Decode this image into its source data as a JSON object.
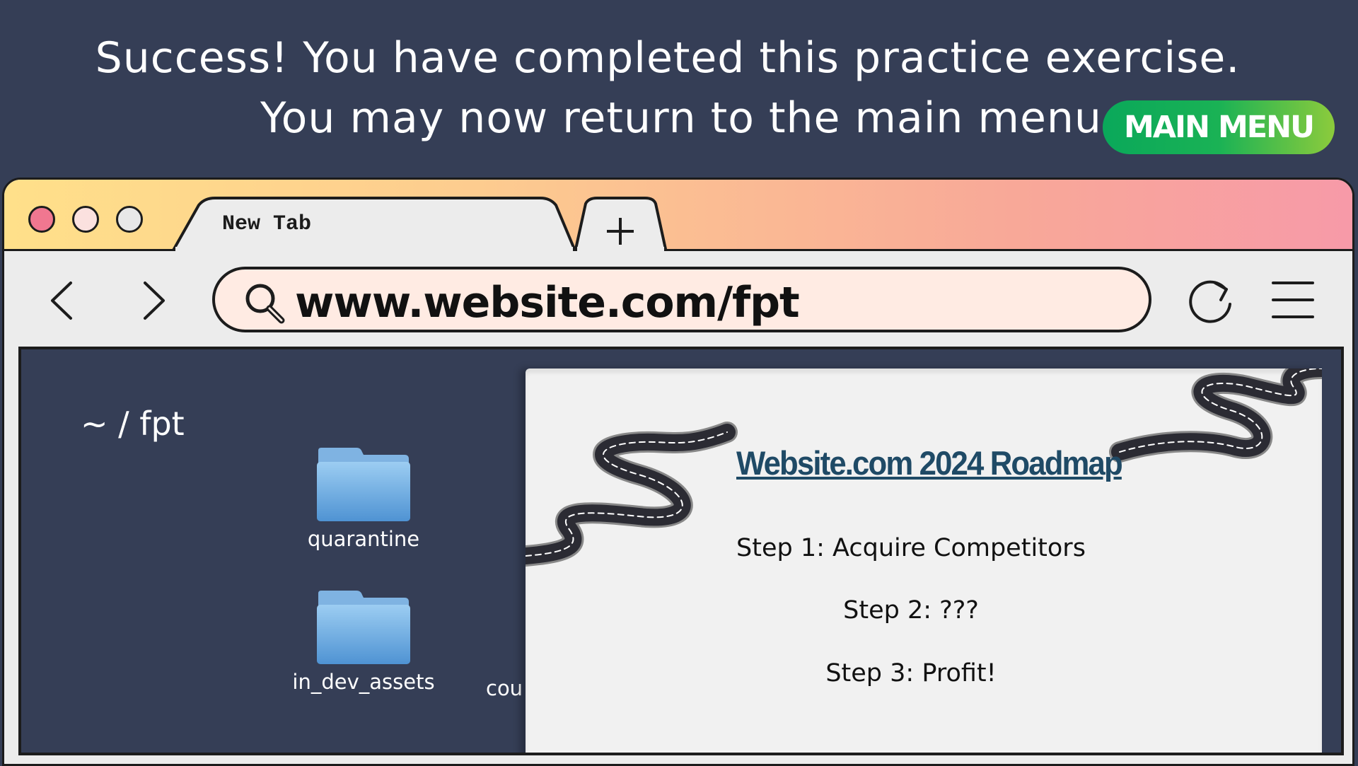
{
  "banner": {
    "line1": "Success! You have completed this practice exercise.",
    "line2": "You may now return to the main menu.",
    "main_menu_label": "MAIN MENU"
  },
  "browser": {
    "tab_title": "New Tab",
    "new_tab_icon": "plus-icon",
    "address": "www.website.com/fpt",
    "icons": [
      "back-arrow-icon",
      "forward-arrow-icon",
      "search-icon",
      "reload-icon",
      "hamburger-menu-icon"
    ]
  },
  "explorer": {
    "path": "~ / fpt",
    "folders": [
      {
        "label": "quarantine",
        "icon": "folder-icon"
      },
      {
        "label": "in_dev_assets",
        "icon": "folder-icon"
      }
    ],
    "clipped_item_label": "cou"
  },
  "document": {
    "title": "Website.com 2024 Roadmap",
    "steps": [
      "Step 1: Acquire Competitors",
      "Step 2: ???",
      "Step 3: Profit!"
    ],
    "decoration": "winding-road-image"
  },
  "colors": {
    "background": "#353e56",
    "button_green": "#1ab255",
    "title_blue": "#1f4a66",
    "address_bg": "#ffebe3"
  }
}
